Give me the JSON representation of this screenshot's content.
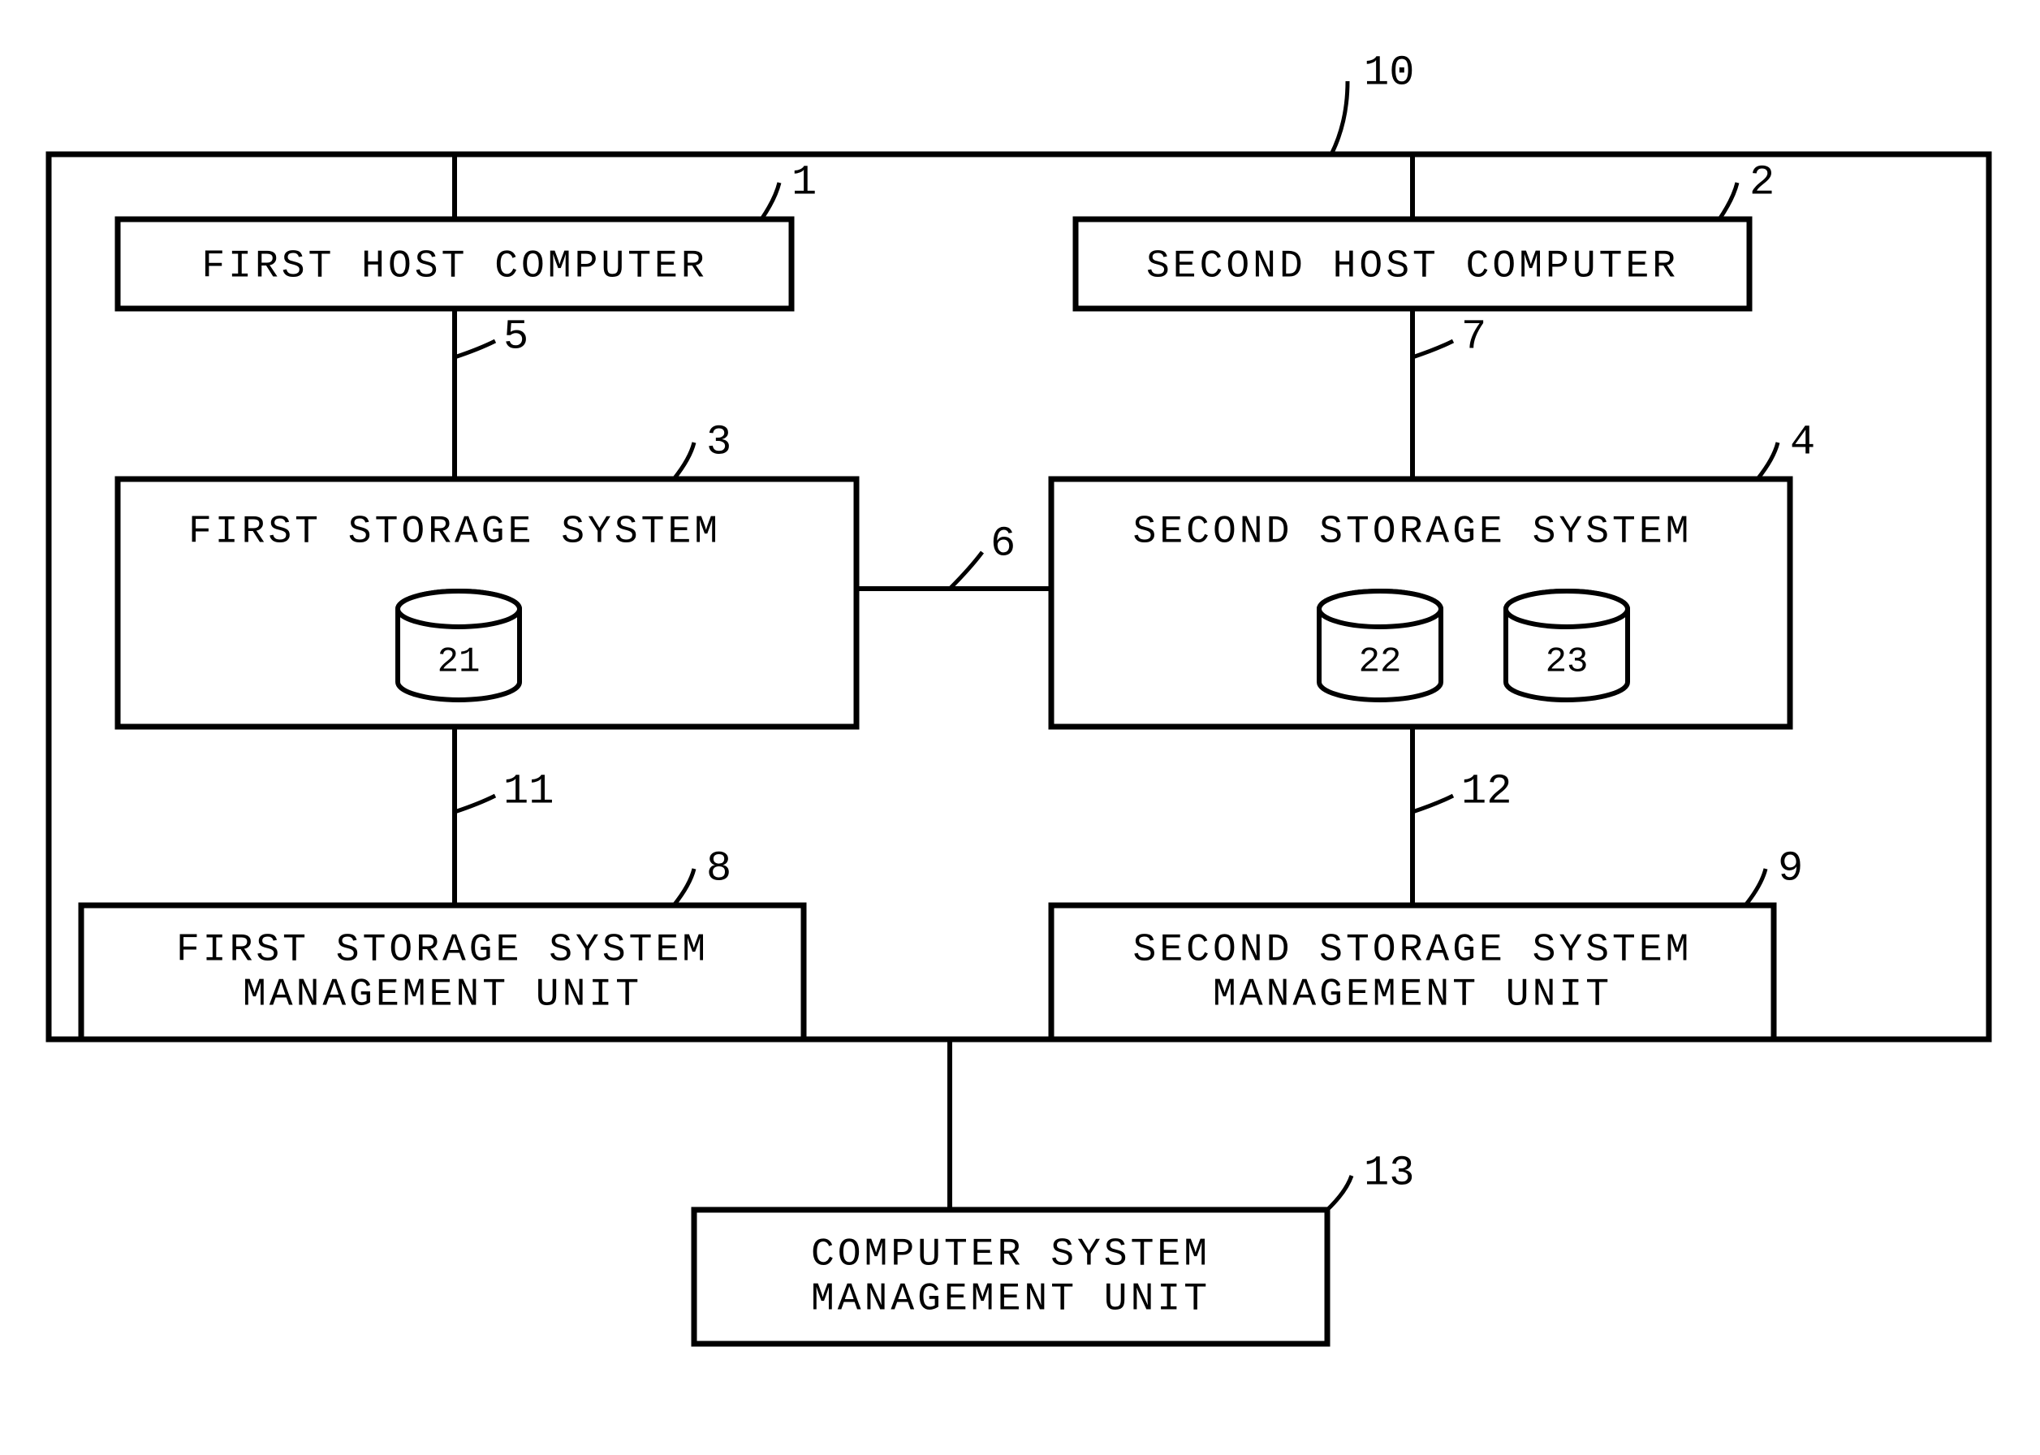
{
  "refs": {
    "system": "10",
    "host1": "1",
    "host2": "2",
    "storage1": "3",
    "storage2": "4",
    "link_h1_s1": "5",
    "link_s1_s2": "6",
    "link_h2_s2": "7",
    "mgmt1": "8",
    "mgmt2": "9",
    "link_s1_m1": "11",
    "link_s2_m2": "12",
    "csmu": "13",
    "vol1": "21",
    "vol2": "22",
    "vol3": "23"
  },
  "labels": {
    "host1": "FIRST HOST COMPUTER",
    "host2": "SECOND HOST COMPUTER",
    "storage1": "FIRST STORAGE SYSTEM",
    "storage2": "SECOND STORAGE SYSTEM",
    "mgmt1_l1": "FIRST STORAGE SYSTEM",
    "mgmt1_l2": "MANAGEMENT UNIT",
    "mgmt2_l1": "SECOND STORAGE SYSTEM",
    "mgmt2_l2": "MANAGEMENT UNIT",
    "csmu_l1": "COMPUTER SYSTEM",
    "csmu_l2": "MANAGEMENT UNIT"
  }
}
